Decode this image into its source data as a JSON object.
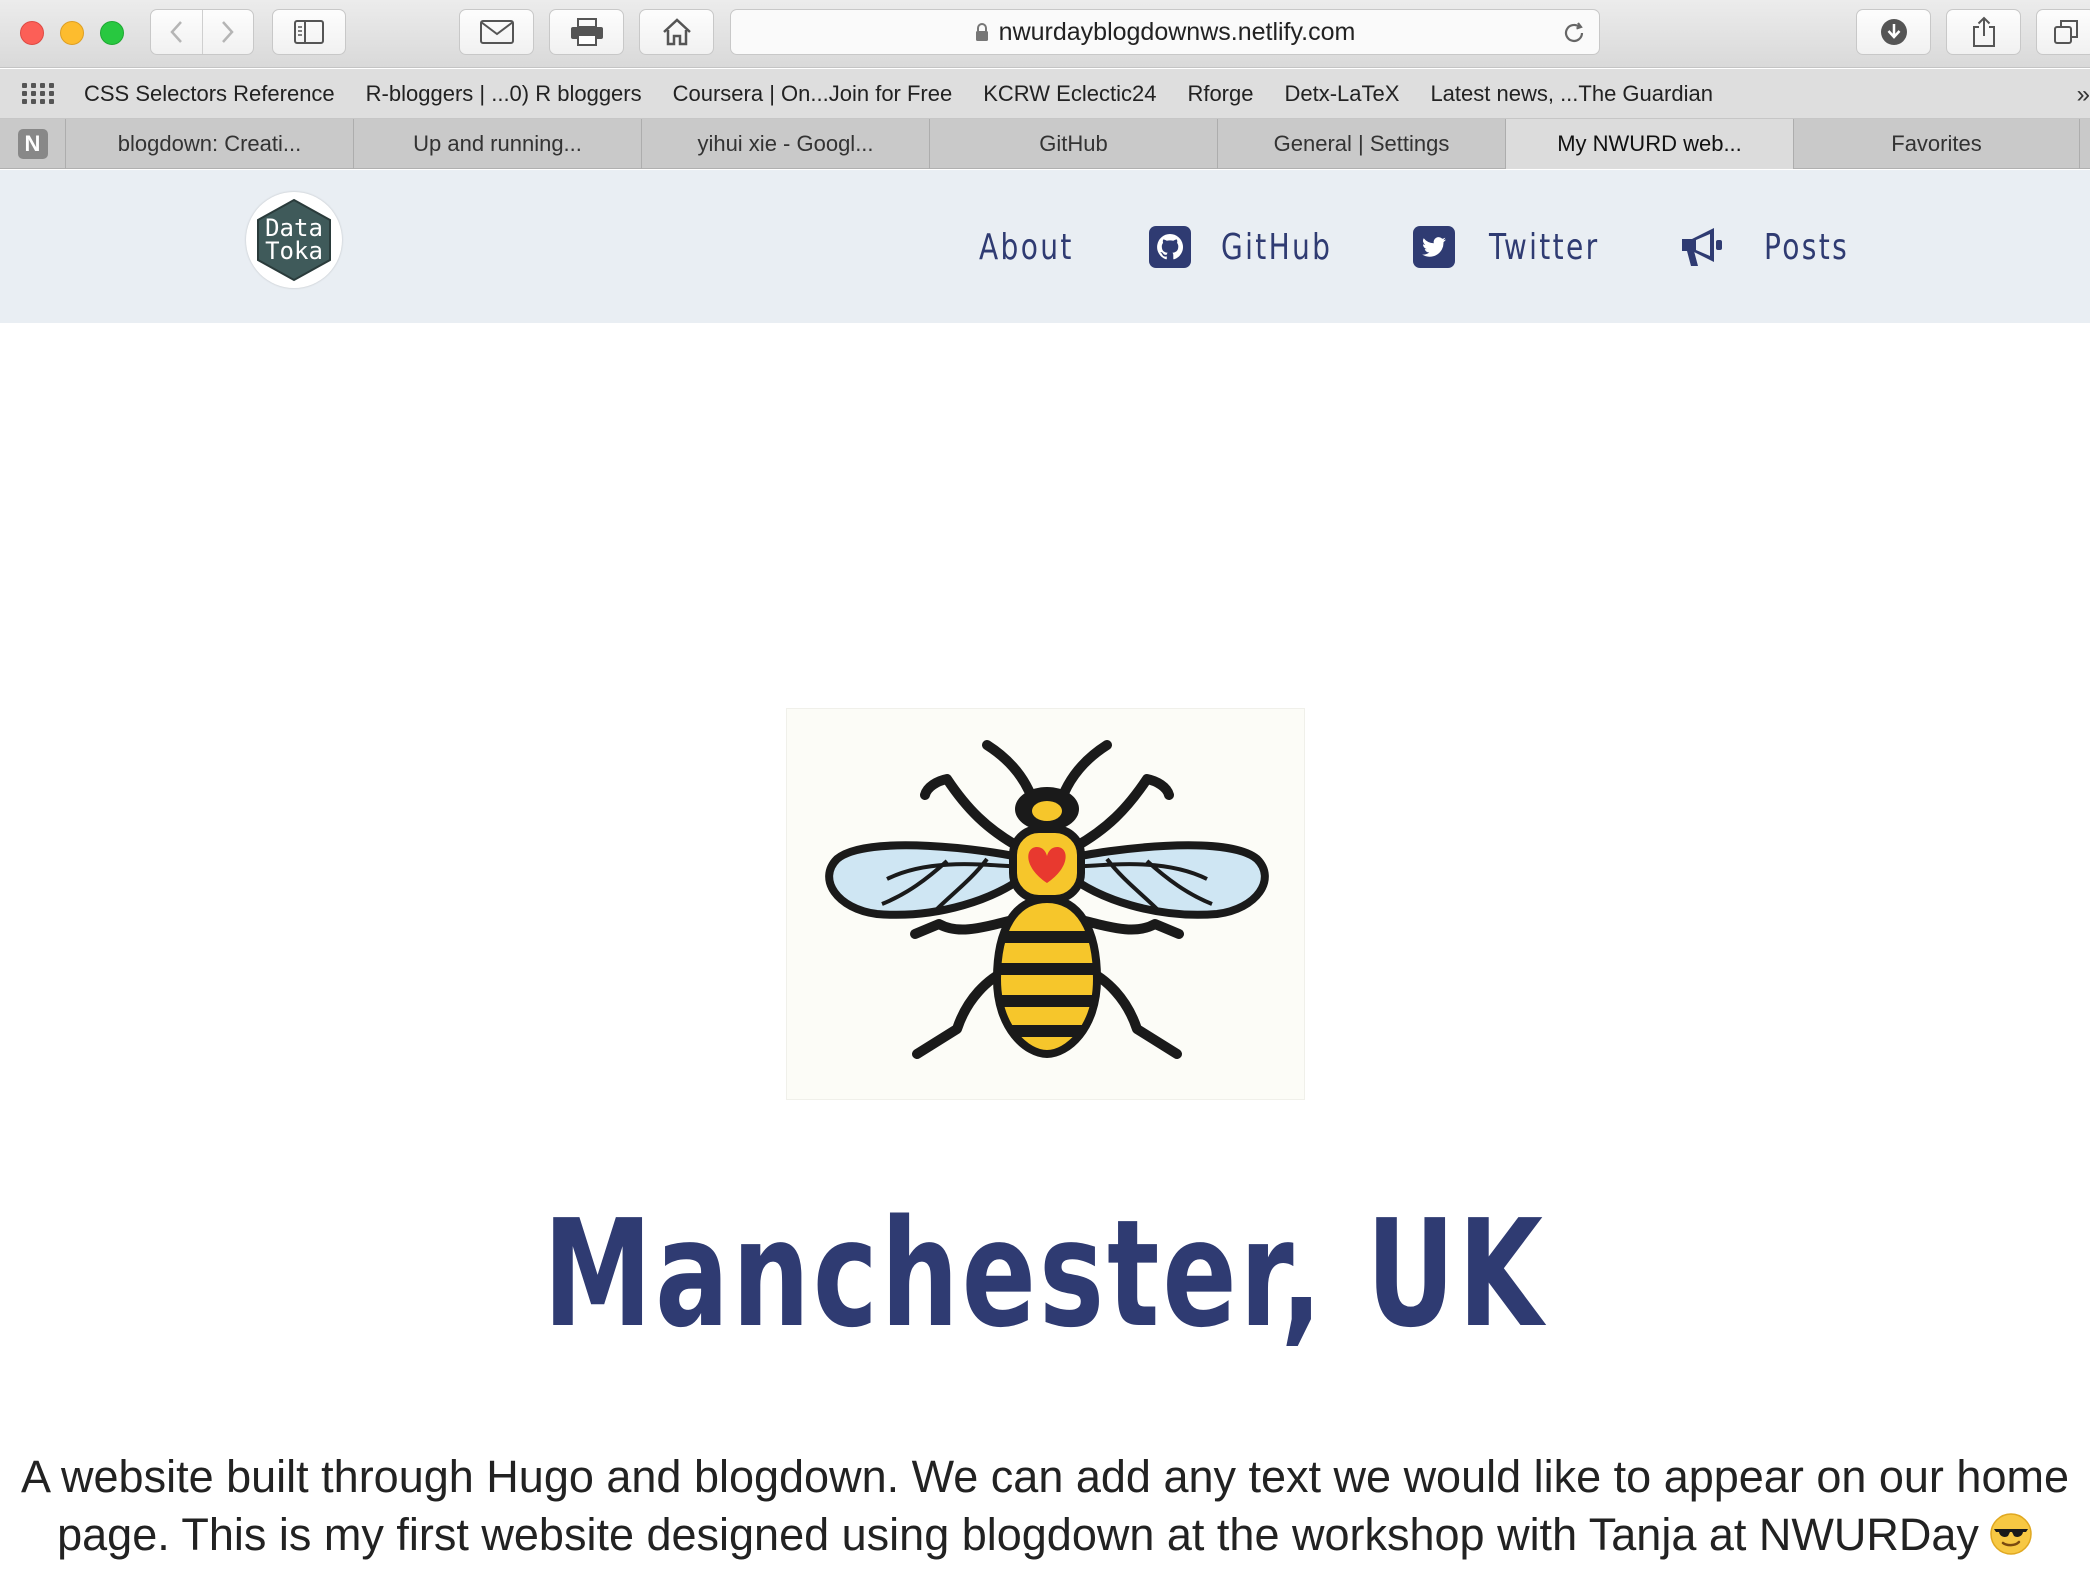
{
  "browser": {
    "url": "nwurdayblogdownws.netlify.com",
    "bookmarks": [
      "CSS Selectors Reference",
      "R-bloggers | ...0) R bloggers",
      "Coursera | On...Join for Free",
      "KCRW Eclectic24",
      "Rforge",
      "Detx-LaTeX",
      "Latest news, ...The Guardian"
    ],
    "bookmarks_more": "»",
    "pinned_tab_letter": "N",
    "tabs": [
      {
        "label": "blogdown: Creati..."
      },
      {
        "label": "Up and running..."
      },
      {
        "label": "yihui xie - Googl..."
      },
      {
        "label": "GitHub"
      },
      {
        "label": "General | Settings"
      },
      {
        "label": "My NWURD web...",
        "active": true
      },
      {
        "label": "Favorites"
      }
    ]
  },
  "site": {
    "logo_text_line1": "Data",
    "logo_text_line2": "Toka",
    "nav": {
      "about": "About",
      "github": "GitHub",
      "twitter": "Twitter",
      "posts": "Posts"
    },
    "title": "Manchester, UK",
    "intro": "A website built through Hugo and blogdown. We can add any text we would like to appear on our home page. This is my first website designed using blogdown at the workshop with Tanja at NWURDay"
  },
  "colors": {
    "nav_text": "#2f3b72",
    "header_bg": "#e9eef3",
    "bee_yellow": "#f6c62b",
    "heart_red": "#e8392f"
  },
  "icons": [
    "grid-icon",
    "github-icon",
    "twitter-icon",
    "megaphone-icon",
    "sunglasses-emoji-icon"
  ]
}
